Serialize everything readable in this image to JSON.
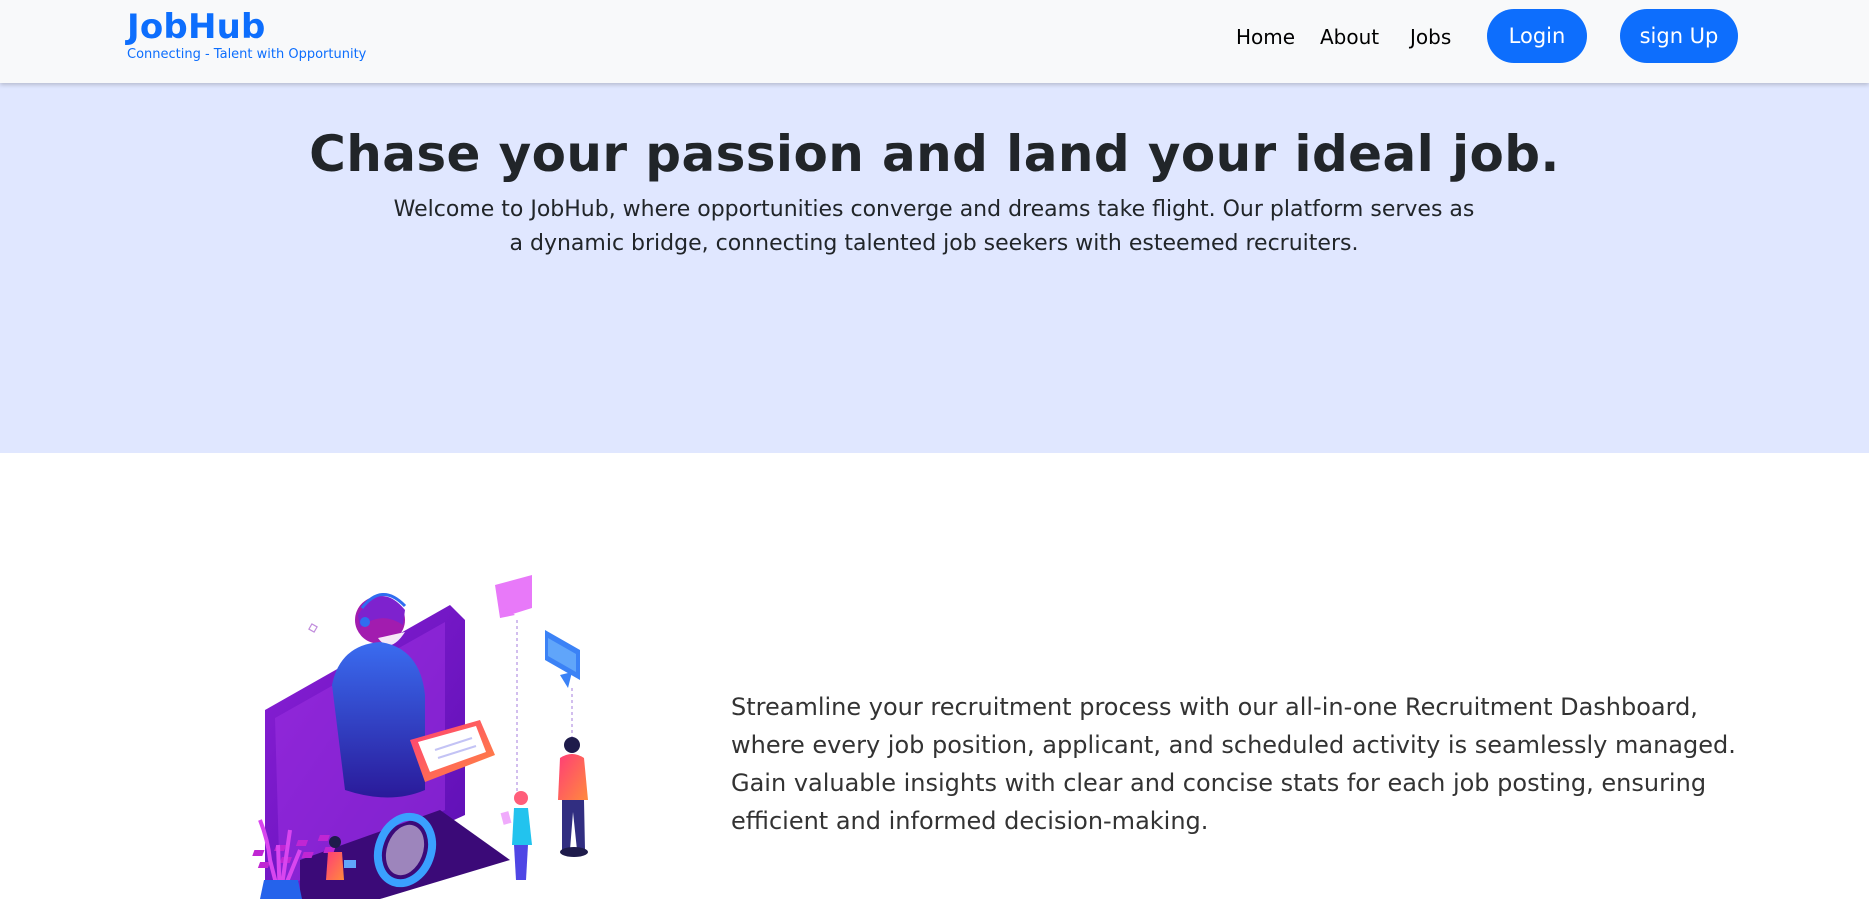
{
  "brand": {
    "name": "JobHub",
    "tagline": "Connecting - Talent with Opportunity",
    "color": "#0d6efd"
  },
  "nav": {
    "links": [
      "Home",
      "About",
      "Jobs"
    ],
    "login_label": "Login",
    "signup_label": "sign Up"
  },
  "hero": {
    "title": "Chase your passion and land your ideal job.",
    "subtitle": "Welcome to JobHub, where opportunities converge and dreams take flight. Our platform serves as a dynamic bridge, connecting talented job seekers with esteemed recruiters.",
    "background": "#e0e7ff"
  },
  "feature": {
    "illustration_icon": "recruiter-at-laptop-illustration",
    "text": "Streamline your recruitment process with our all-in-one Recruitment Dashboard, where every job position, applicant, and scheduled activity is seamlessly managed. Gain valuable insights with clear and concise stats for each job posting, ensuring efficient and informed decision-making."
  }
}
